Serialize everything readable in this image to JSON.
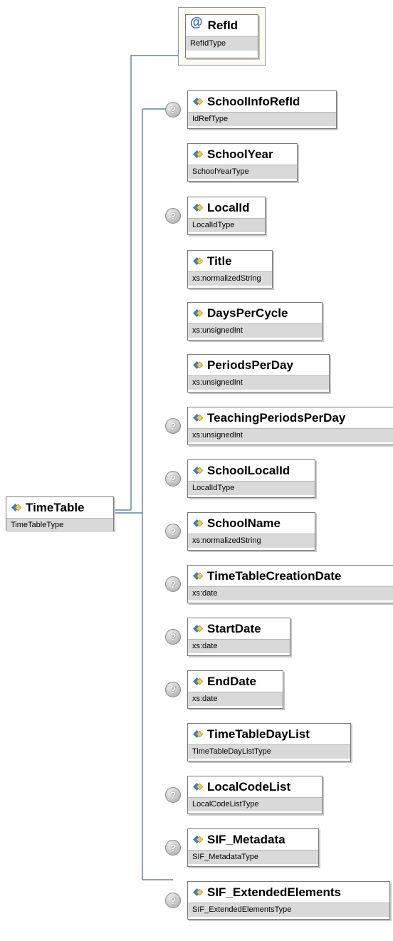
{
  "root": {
    "name": "TimeTable",
    "type": "TimeTableType"
  },
  "attribute": {
    "symbol": "@",
    "name": "RefId",
    "type": "RefIdType"
  },
  "optional_marker": "?",
  "colors": {
    "connector": "#3c6e8a",
    "type_band": "#d9d9d9",
    "attribute_accent": "#2a5db0",
    "attribute_bg": "#fbfbf0"
  },
  "icons": {
    "element": "element-diamond-icon",
    "optional": "optional-question-icon"
  },
  "children": [
    {
      "name": "SchoolInfoRefId",
      "type": "IdRefType",
      "optional": true
    },
    {
      "name": "SchoolYear",
      "type": "SchoolYearType",
      "optional": false
    },
    {
      "name": "LocalId",
      "type": "LocalIdType",
      "optional": true
    },
    {
      "name": "Title",
      "type": "xs:normalizedString",
      "optional": false
    },
    {
      "name": "DaysPerCycle",
      "type": "xs:unsignedInt",
      "optional": false
    },
    {
      "name": "PeriodsPerDay",
      "type": "xs:unsignedInt",
      "optional": false
    },
    {
      "name": "TeachingPeriodsPerDay",
      "type": "xs:unsignedInt",
      "optional": true
    },
    {
      "name": "SchoolLocalId",
      "type": "LocalIdType",
      "optional": true
    },
    {
      "name": "SchoolName",
      "type": "xs:normalizedString",
      "optional": true
    },
    {
      "name": "TimeTableCreationDate",
      "type": "xs:date",
      "optional": true
    },
    {
      "name": "StartDate",
      "type": "xs:date",
      "optional": true
    },
    {
      "name": "EndDate",
      "type": "xs:date",
      "optional": true
    },
    {
      "name": "TimeTableDayList",
      "type": "TimeTableDayListType",
      "optional": false
    },
    {
      "name": "LocalCodeList",
      "type": "LocalCodeListType",
      "optional": true
    },
    {
      "name": "SIF_Metadata",
      "type": "SIF_MetadataType",
      "optional": true
    },
    {
      "name": "SIF_ExtendedElements",
      "type": "SIF_ExtendedElementsType",
      "optional": true
    }
  ]
}
